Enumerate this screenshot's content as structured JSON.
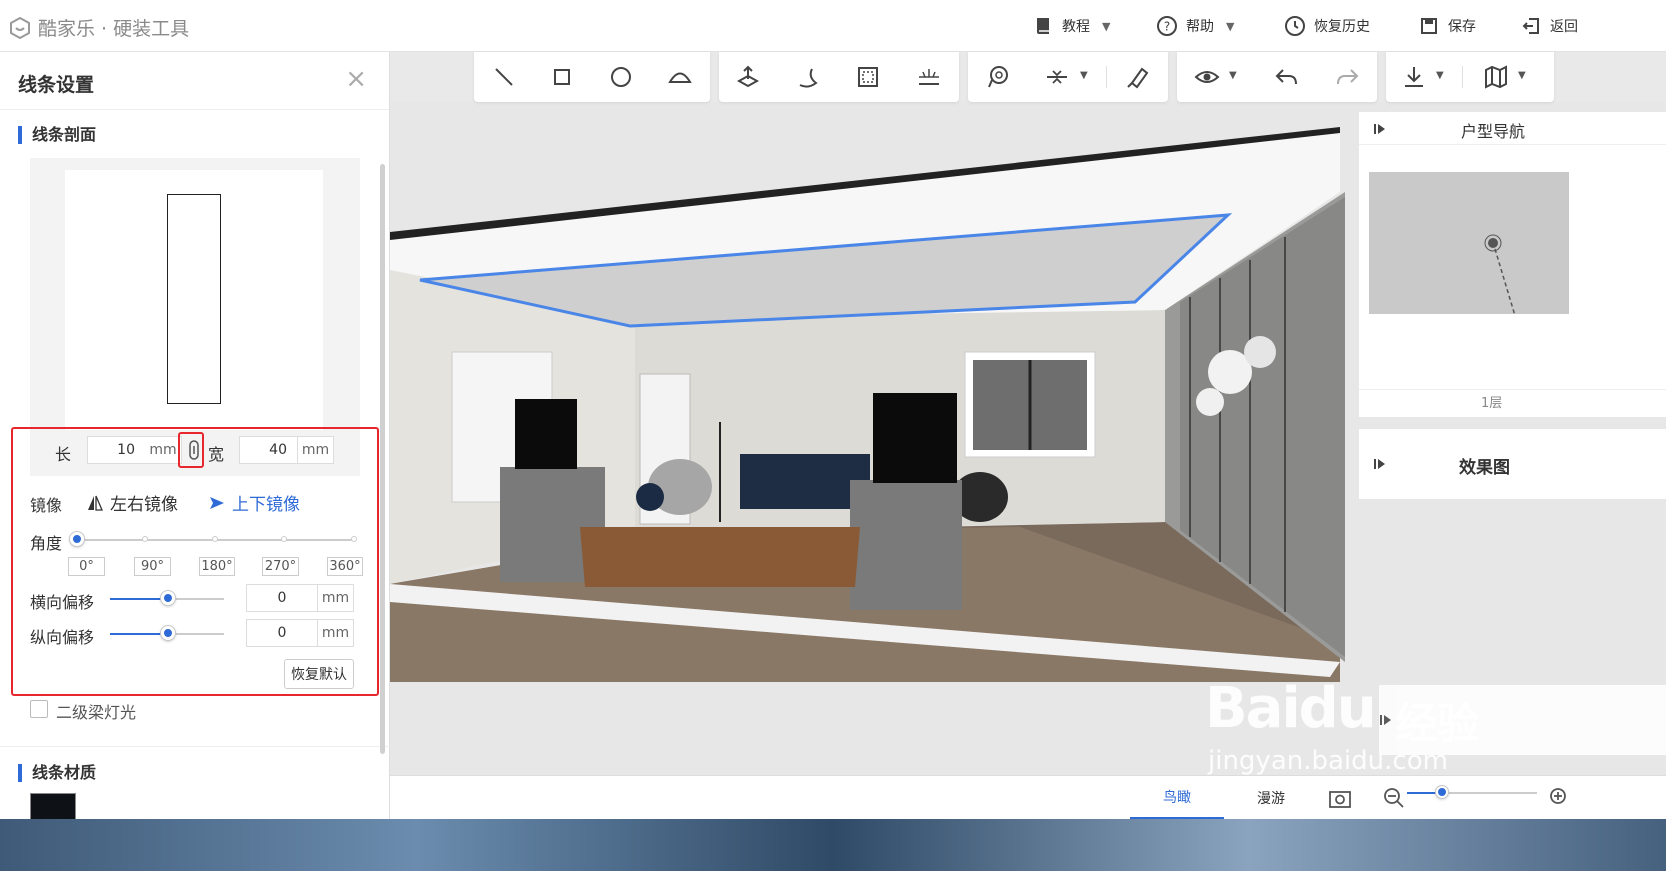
{
  "app": {
    "logo_text": "酷家乐 · 硬装工具"
  },
  "top_menu": {
    "tutorial": "教程",
    "help": "帮助",
    "restore_history": "恢复历史",
    "save": "保存",
    "back": "返回"
  },
  "panel": {
    "title": "线条设置",
    "close": "×",
    "profile_section": "线条剖面",
    "length_label": "长",
    "length_value": "10",
    "length_unit": "mm",
    "width_label": "宽",
    "width_value": "40",
    "width_unit": "mm",
    "mirror_label": "镜像",
    "mirror_lr": "左右镜像",
    "mirror_tb": "上下镜像",
    "angle_label": "角度",
    "angle_value": 0,
    "angle_ticks": [
      "0°",
      "90°",
      "180°",
      "270°",
      "360°"
    ],
    "h_offset_label": "横向偏移",
    "h_offset_value": "0",
    "h_offset_unit": "mm",
    "v_offset_label": "纵向偏移",
    "v_offset_value": "0",
    "v_offset_unit": "mm",
    "reset_button": "恢复默认",
    "beam_light_label": "二级梁灯光",
    "beam_light_checked": false,
    "material_section": "线条材质",
    "material_color": "#0e1116"
  },
  "viewport": {
    "nav_card_title": "户型导航",
    "floor_label": "1层",
    "render_card_title": "效果图"
  },
  "bottom_bar": {
    "tab_bird": "鸟瞰",
    "tab_roam": "漫游",
    "active_tab": "鸟瞰"
  },
  "watermark": {
    "brand": "Baidu",
    "cn": "经验",
    "url": "jingyan.baidu.com"
  },
  "colors": {
    "accent": "#2f6bd6",
    "highlight": "#e8262d"
  }
}
